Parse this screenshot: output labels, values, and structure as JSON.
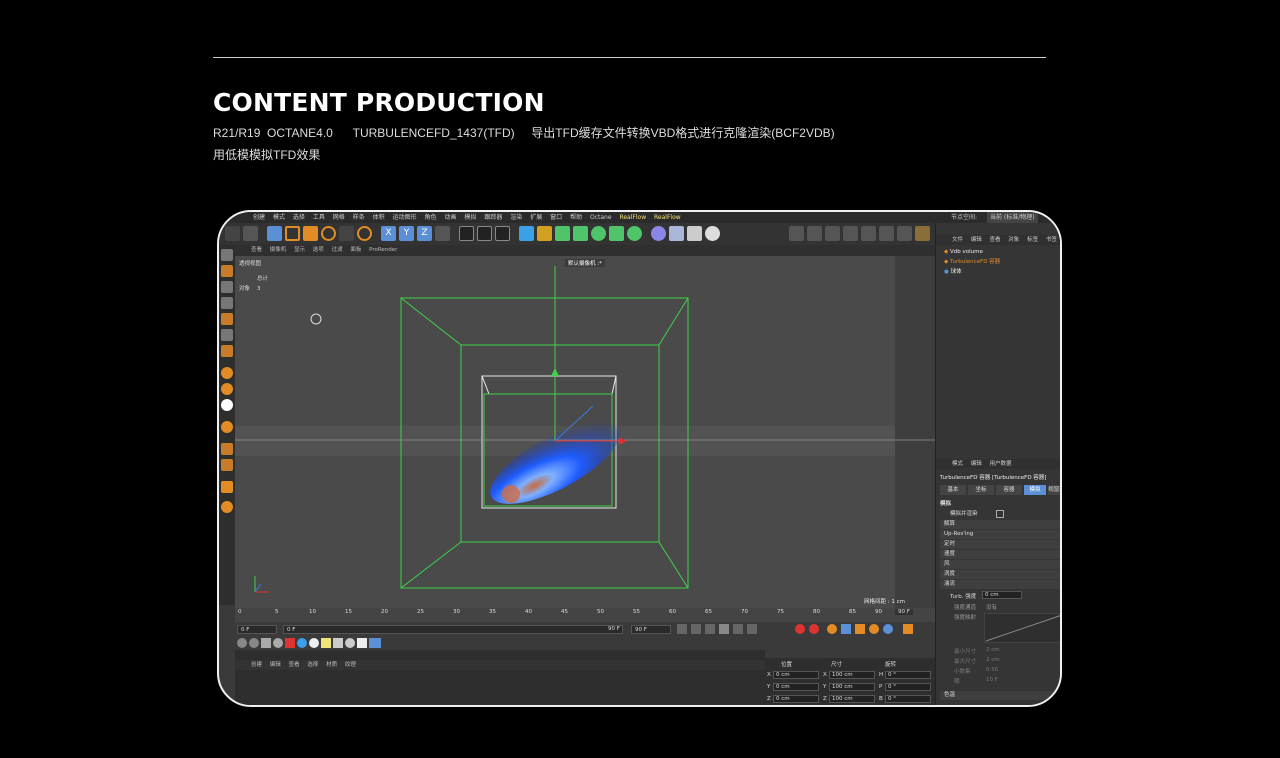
{
  "header": {
    "title": "CONTENT PRODUCTION",
    "line1": "R21/R19  OCTANE4.0      TURBULENCEFD_1437(TFD)     导出TFD缓存文件转换VBD格式进行克隆渲染(BCF2VDB)",
    "line2": "用低模模拟TFD效果"
  },
  "app": {
    "menu": [
      "创建",
      "模式",
      "选择",
      "工具",
      "网格",
      "样条",
      "体积",
      "运动图形",
      "角色",
      "动画",
      "模拟",
      "跟踪器",
      "渲染",
      "扩展",
      "窗口",
      "帮助",
      "Octane",
      "RealFlow",
      "RealFlow"
    ],
    "node_space_label": "节点空间:",
    "node_space_value": "当前 (标准/物理)",
    "viewport": {
      "menu": [
        "查看",
        "摄像机",
        "显示",
        "选项",
        "过滤",
        "面板",
        "ProRender"
      ],
      "title": "透视视图",
      "stats_label": "总计",
      "objects_label": "对象",
      "objects_value": "3",
      "camera_label": "默认摄像机 :*",
      "grid_label": "网格间距 : 1 cm"
    },
    "timeline": {
      "ticks": [
        "0",
        "5",
        "10",
        "15",
        "20",
        "25",
        "30",
        "35",
        "40",
        "45",
        "50",
        "55",
        "60",
        "65",
        "70",
        "75",
        "80",
        "85",
        "90"
      ],
      "current_frame": "90 F",
      "start_field": "0 F",
      "start_field2": "0 F",
      "end_field": "90 F",
      "end_field2": "90 F"
    },
    "materials_menu": [
      "创建",
      "编辑",
      "查看",
      "选择",
      "材质",
      "纹理"
    ],
    "coords": {
      "position_label": "位置",
      "size_label": "尺寸",
      "rotation_label": "旋转",
      "rows": [
        {
          "axis": "X",
          "pos": "0 cm",
          "size_axis": "X",
          "size": "100 cm",
          "rot_axis": "H",
          "rot": "0 °"
        },
        {
          "axis": "Y",
          "pos": "0 cm",
          "size_axis": "Y",
          "size": "100 cm",
          "rot_axis": "P",
          "rot": "0 °"
        },
        {
          "axis": "Z",
          "pos": "0 cm",
          "size_axis": "Z",
          "size": "100 cm",
          "rot_axis": "B",
          "rot": "0 °"
        }
      ]
    },
    "objects": {
      "menu": [
        "文件",
        "编辑",
        "查看",
        "对象",
        "标签",
        "书签"
      ],
      "items": [
        "Vdb volume",
        "TurbulenceFD 容器",
        "球体"
      ]
    },
    "attributes": {
      "menu": [
        "模式",
        "编辑",
        "用户数据"
      ],
      "title": "TurbulenceFD 容器 [TurbulenceFD 容器]",
      "tabs": [
        "基本",
        "坐标",
        "容器",
        "模拟",
        "视窗预"
      ],
      "section": "模拟",
      "sim_render": "模拟并渲染",
      "groups": [
        "解算",
        "Up-Res'ing",
        "定时",
        "速度",
        "风",
        "涡度",
        "湍流"
      ],
      "turb_label": "Turb. 强度",
      "turb_value": "0 cm",
      "turb_channel": "强度通道",
      "turb_channel_value": "没有",
      "turb_map": "强度映射",
      "min_size": "最小尺寸",
      "min_size_value": "2 cm",
      "max_size": "最大尺寸",
      "max_size_value": "2 cm",
      "decimal": "小数集",
      "decimal_value": "0.56",
      "period": "期",
      "period_value": "10 F",
      "color_section": "色温"
    }
  },
  "colors": {
    "accent_blue": "#5b8fd6",
    "wire_green": "#3fd24a",
    "fluid_blue": "#1e5cff",
    "background": "#000000"
  }
}
